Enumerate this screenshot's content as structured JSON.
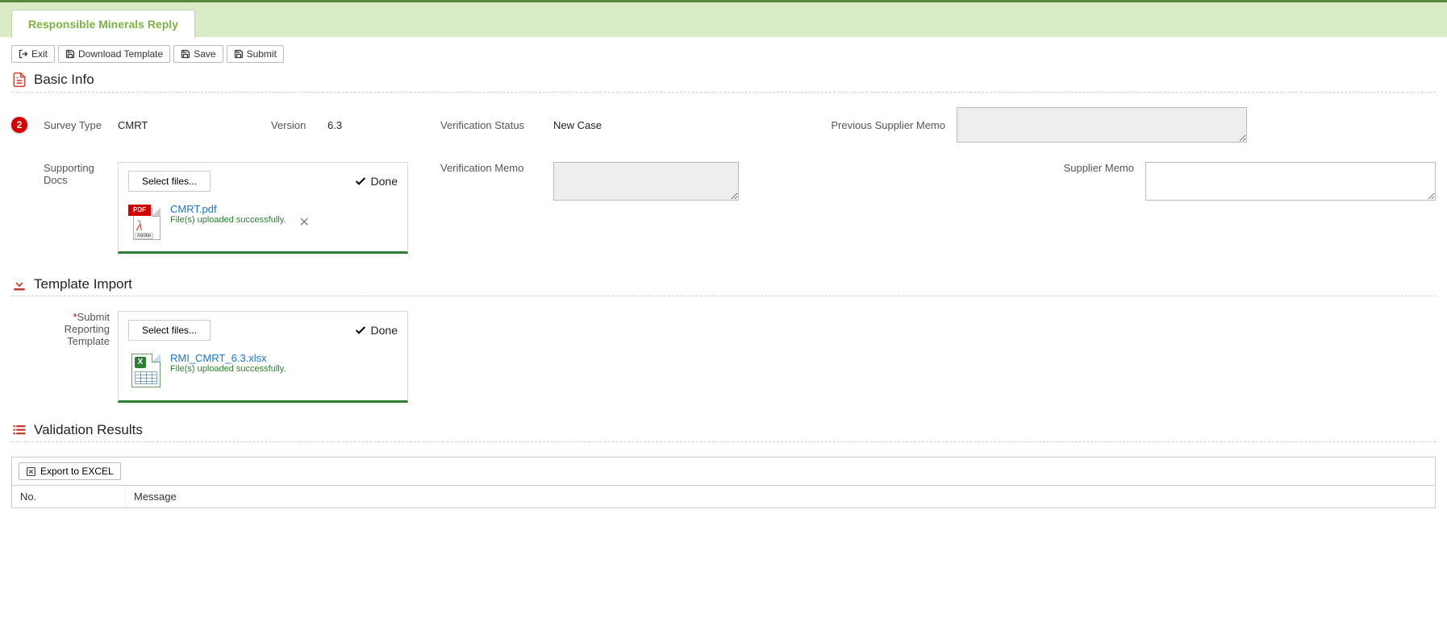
{
  "tab": {
    "label": "Responsible Minerals Reply"
  },
  "toolbar": {
    "exit": "Exit",
    "download_template": "Download Template",
    "save": "Save",
    "submit": "Submit"
  },
  "sections": {
    "basic_info": "Basic Info",
    "template_import": "Template Import",
    "validation_results": "Validation Results"
  },
  "badge": "2",
  "labels": {
    "survey_type": "Survey Type",
    "version": "Version",
    "verification_status": "Verification Status",
    "previous_supplier_memo": "Previous Supplier Memo",
    "supporting_docs": "Supporting Docs",
    "verification_memo": "Verification Memo",
    "supplier_memo": "Supplier Memo",
    "submit_reporting_template": "Submit Reporting Template"
  },
  "values": {
    "survey_type": "CMRT",
    "version": "6.3",
    "verification_status": "New Case"
  },
  "upload": {
    "select_files": "Select files...",
    "done": "Done",
    "success_msg": "File(s) uploaded successfully."
  },
  "files": {
    "pdf_name": "CMRT.pdf",
    "xlsx_name": "RMI_CMRT_6.3.xlsx"
  },
  "results": {
    "export": "Export to EXCEL",
    "col_no": "No.",
    "col_message": "Message"
  }
}
